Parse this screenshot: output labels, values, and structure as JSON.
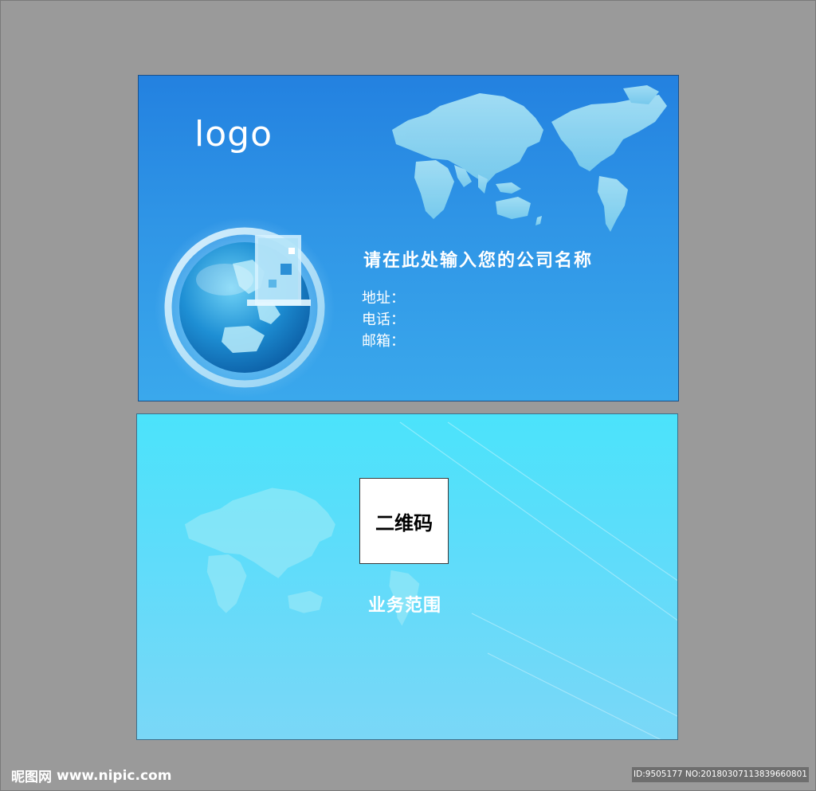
{
  "front_card": {
    "logo": "logo",
    "company_name": "请在此处输入您的公司名称",
    "address_label": "地址：",
    "phone_label": "电话：",
    "email_label": "邮箱：",
    "background_top": "#2381e0",
    "background_bottom": "#3aa8ec"
  },
  "back_card": {
    "qr_label": "二维码",
    "business_scope": "业务范围",
    "background_top": "#4be3fb",
    "background_bottom": "#7ad7f7"
  },
  "watermark": {
    "site_name": "昵图网",
    "site_url": "www.nipic.com",
    "image_id": "ID:9505177 NO:20180307113839660801"
  }
}
